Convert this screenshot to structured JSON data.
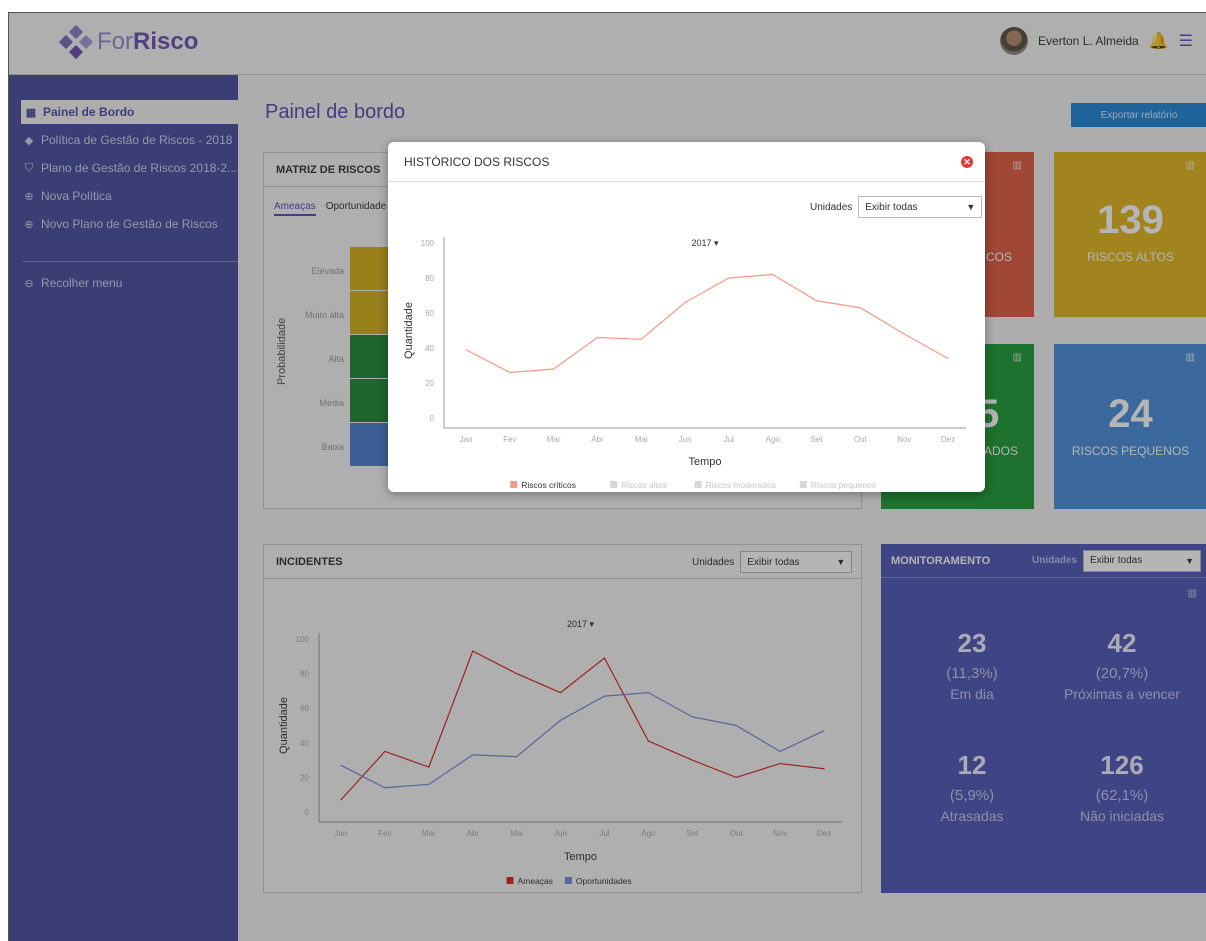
{
  "app": {
    "brand_light": "For",
    "brand_bold": "Risco"
  },
  "user": {
    "name": "Everton L. Almeida"
  },
  "sidebar": {
    "items": [
      {
        "label": "Painel de Bordo",
        "icon": "grid-icon"
      },
      {
        "label": "Política de Gestão de Riscos - 2018",
        "icon": "gavel-icon"
      },
      {
        "label": "Plano de Gestão de Riscos 2018-2...",
        "icon": "shield-icon"
      },
      {
        "label": "Nova Política",
        "icon": "plus-circle-icon"
      },
      {
        "label": "Novo Plano de Gestão de Riscos",
        "icon": "plus-circle-icon"
      }
    ],
    "collapse_label": "Recolher menu"
  },
  "main": {
    "title": "Painel de bordo",
    "export_label": "Exportar relatório"
  },
  "matrix": {
    "title": "MATRIZ DE RISCOS",
    "tabs": [
      "Ameaças",
      "Oportunidade"
    ],
    "rows": [
      "Elevada",
      "Muito alta",
      "Alta",
      "Média",
      "Baixa"
    ],
    "axis_label": "Probabilidade",
    "colors": [
      "#d4b21a",
      "#d4b21a",
      "#1f8a35",
      "#1f8a35",
      "#4a7fd0"
    ]
  },
  "kpis": {
    "critical_label": "COS",
    "high_value": "139",
    "high_label": "RISCOS ALTOS",
    "moderate_value": "5",
    "moderate_label": "ADOS",
    "small_value": "24",
    "small_label": "RISCOS PEQUENOS",
    "colors": {
      "critical": "#e05b42",
      "high": "#e3b71e",
      "moderate": "#1f9a36",
      "small": "#4a8edb"
    }
  },
  "incidents": {
    "title": "INCIDENTES",
    "units_label": "Unidades",
    "units_value": "Exibir todas"
  },
  "monitor": {
    "title": "MONITORAMENTO",
    "units_label": "Unidades",
    "units_value": "Exibir todas",
    "cells": [
      {
        "n": "23",
        "p": "(11,3%)",
        "t": "Em dia"
      },
      {
        "n": "42",
        "p": "(20,7%)",
        "t": "Próximas a vencer"
      },
      {
        "n": "12",
        "p": "(5,9%)",
        "t": "Atrasadas"
      },
      {
        "n": "126",
        "p": "(62,1%)",
        "t": "Não iniciadas"
      }
    ]
  },
  "modal": {
    "title": "HISTÓRICO DOS RISCOS",
    "units_label": "Unidades",
    "units_value": "Exibir todas"
  },
  "chart_data": [
    {
      "type": "line",
      "year_label": "2017 ▾",
      "x": [
        "Jan",
        "Fev",
        "Mar",
        "Abr",
        "Mai",
        "Jun",
        "Jul",
        "Ago",
        "Set",
        "Out",
        "Nov",
        "Dez"
      ],
      "series": [
        {
          "name": "Riscos críticos",
          "color": "#f5998a",
          "values": [
            39,
            26,
            28,
            46,
            45,
            66,
            80,
            82,
            67,
            63,
            48,
            34
          ]
        },
        {
          "name": "Riscos altos",
          "color": "#cccccc",
          "values": []
        },
        {
          "name": "Riscos moderados",
          "color": "#cccccc",
          "values": []
        },
        {
          "name": "Riscos pequenos",
          "color": "#cccccc",
          "values": []
        }
      ],
      "xlabel": "Tempo",
      "ylabel": "Quantidade",
      "ylim": [
        0,
        100
      ],
      "yticks": [
        0,
        20,
        40,
        60,
        80,
        100
      ],
      "legend": "bottom"
    },
    {
      "type": "line",
      "year_label": "2017 ▾",
      "x": [
        "Jan",
        "Fev",
        "Mar",
        "Abr",
        "Mai",
        "Jun",
        "Jul",
        "Ago",
        "Set",
        "Out",
        "Nov",
        "Dez"
      ],
      "series": [
        {
          "name": "Ameaças",
          "color": "#d8261f",
          "values": [
            7,
            35,
            26,
            93,
            80,
            69,
            89,
            41,
            30,
            20,
            28,
            25
          ]
        },
        {
          "name": "Oportunidades",
          "color": "#7c86d8",
          "values": [
            27,
            14,
            16,
            33,
            32,
            53,
            67,
            69,
            55,
            50,
            35,
            47
          ]
        }
      ],
      "xlabel": "Tempo",
      "ylabel": "Quantidade",
      "ylim": [
        0,
        100
      ],
      "yticks": [
        0,
        20,
        40,
        60,
        80,
        100
      ],
      "legend": "bottom"
    }
  ]
}
